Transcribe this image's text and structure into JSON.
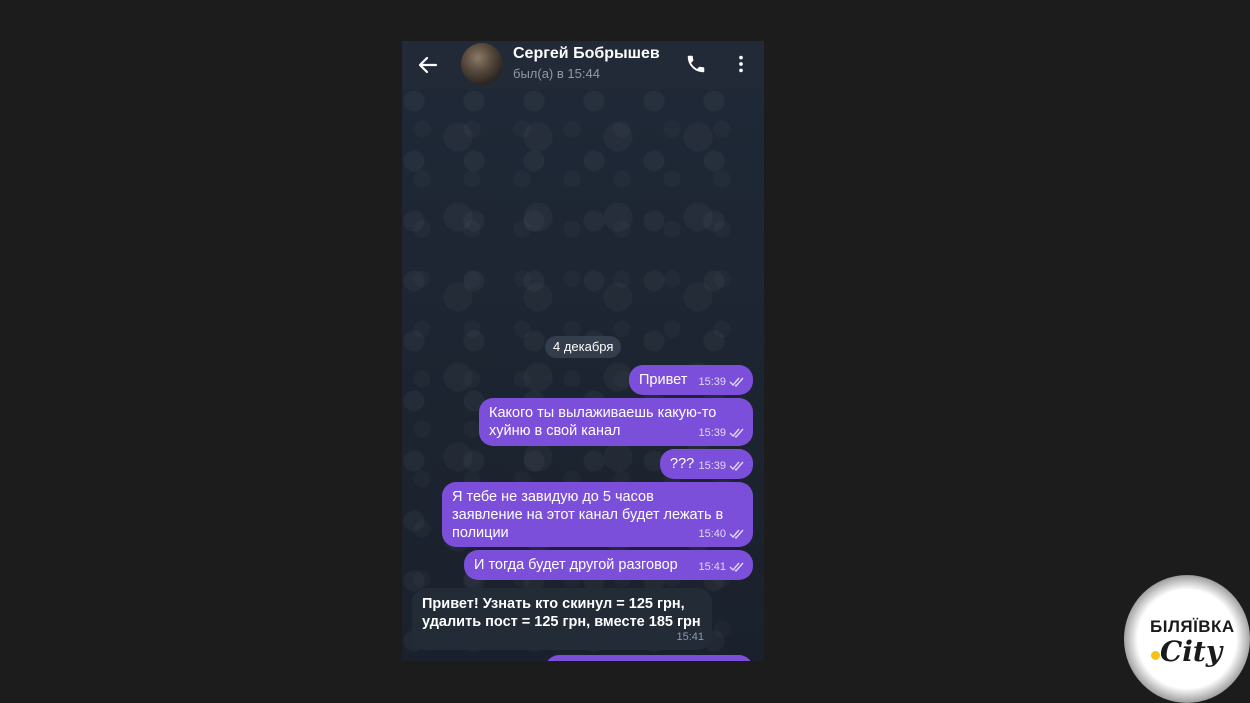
{
  "chat": {
    "contact_name": "Сергей Бобрышев",
    "status": "был(а) в 15:44",
    "date_divider": "4 декабря"
  },
  "icons": {
    "back": "back-arrow-icon",
    "call": "phone-icon",
    "menu": "more-vert-icon",
    "read": "double-check-icon"
  },
  "colors": {
    "outgoing_bubble": "#7b4fd9",
    "incoming_bubble": "#232b37",
    "header": "#222a37",
    "logo_dot": "#f3c316"
  },
  "messages": [
    {
      "direction": "out",
      "text": "Привет",
      "time": "15:39"
    },
    {
      "direction": "out",
      "text": "Какого ты вылаживаешь какую-то\nхуйню  в свой канал",
      "time": "15:39"
    },
    {
      "direction": "out",
      "text": "???",
      "time": "15:39"
    },
    {
      "direction": "out",
      "text": "Я тебе не завидую до 5 часов\nзаявление на этот канал будет лежать в\nполиции",
      "time": "15:40"
    },
    {
      "direction": "out",
      "text": "И тогда будет другой разговор",
      "time": "15:41"
    },
    {
      "direction": "in",
      "text": "Привет! Узнать кто скинул = 125 грн,\nудалить пост = 125 грн, вместе 185 грн",
      "time": "15:41"
    }
  ],
  "watermark": {
    "top": "БІЛЯЇВКА",
    "bottom": "City"
  }
}
